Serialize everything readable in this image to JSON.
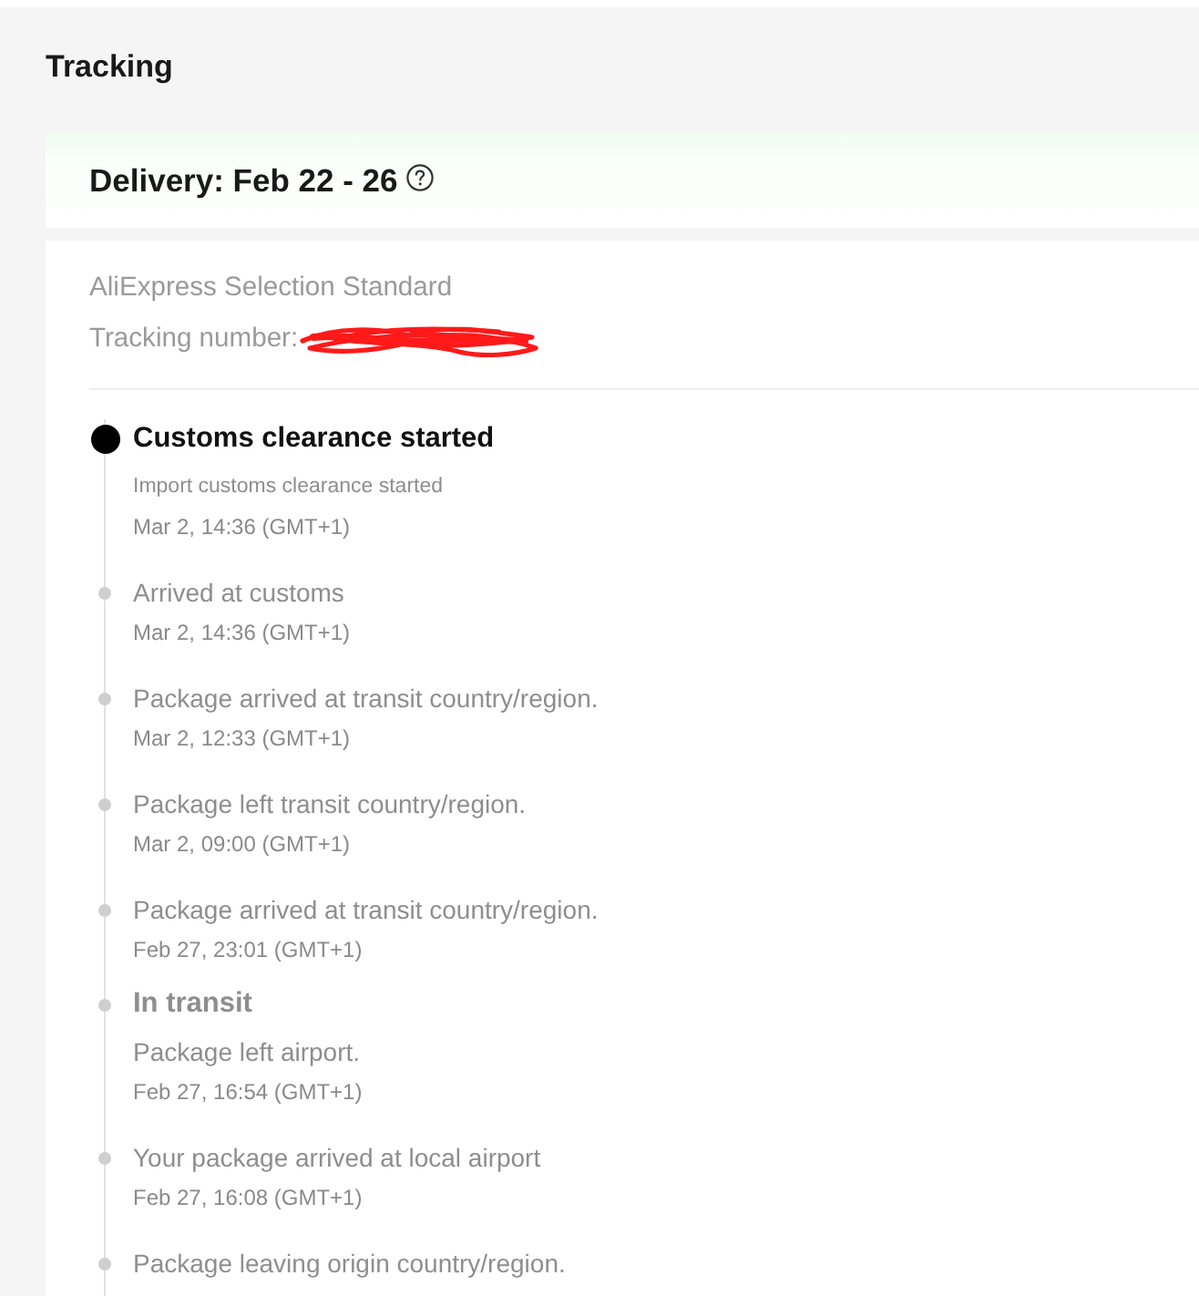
{
  "page": {
    "title": "Tracking"
  },
  "delivery": {
    "label": "Delivery: Feb 22 - 26"
  },
  "shipment": {
    "service": "AliExpress Selection Standard",
    "tracking_label": "Tracking number:",
    "tracking_redacted": true
  },
  "timeline": [
    {
      "kind": "current",
      "heading": "Customs clearance started",
      "text": "Import customs clearance started",
      "time": "Mar 2, 14:36 (GMT+1)"
    },
    {
      "kind": "event",
      "text": "Arrived at customs",
      "time": "Mar 2, 14:36 (GMT+1)"
    },
    {
      "kind": "event",
      "text": "Package arrived at transit country/region.",
      "time": "Mar 2, 12:33 (GMT+1)"
    },
    {
      "kind": "event",
      "text": "Package left transit country/region.",
      "time": "Mar 2, 09:00 (GMT+1)"
    },
    {
      "kind": "event",
      "text": "Package arrived at transit country/region.",
      "time": "Feb 27, 23:01 (GMT+1)"
    },
    {
      "kind": "milestone",
      "heading": "In transit",
      "text": "Package left airport.",
      "time": "Feb 27, 16:54 (GMT+1)"
    },
    {
      "kind": "event",
      "text": "Your package arrived at local airport",
      "time": "Feb 27, 16:08 (GMT+1)"
    },
    {
      "kind": "event",
      "text": "Package leaving origin country/region."
    }
  ]
}
